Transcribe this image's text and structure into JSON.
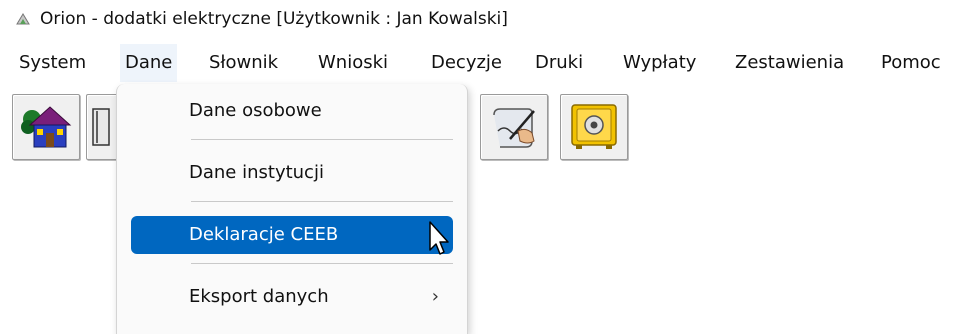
{
  "window": {
    "title": "Orion - dodatki elektryczne  [Użytkownik : Jan Kowalski]",
    "icon": "app-icon"
  },
  "menubar": {
    "items": [
      {
        "label": "System"
      },
      {
        "label": "Dane",
        "active": true
      },
      {
        "label": "Słownik"
      },
      {
        "label": "Wnioski"
      },
      {
        "label": "Decyzje"
      },
      {
        "label": "Druki"
      },
      {
        "label": "Wypłaty"
      },
      {
        "label": "Zestawienia"
      },
      {
        "label": "Pomoc"
      }
    ]
  },
  "toolbar": {
    "buttons": [
      {
        "icon": "house-icon"
      },
      {
        "icon": "book-icon"
      },
      {
        "icon": "signing-hand-icon"
      },
      {
        "icon": "safe-icon"
      }
    ]
  },
  "dropdown": {
    "items": [
      {
        "label": "Dane osobowe",
        "selected": false,
        "submenu": false
      },
      {
        "label": "Dane instytucji",
        "selected": false,
        "submenu": false
      },
      {
        "label": "Deklaracje CEEB",
        "selected": true,
        "submenu": false
      },
      {
        "label": "Eksport danych",
        "selected": false,
        "submenu": true,
        "submenu_glyph": "›"
      }
    ],
    "selected_color": "#0067c0"
  }
}
